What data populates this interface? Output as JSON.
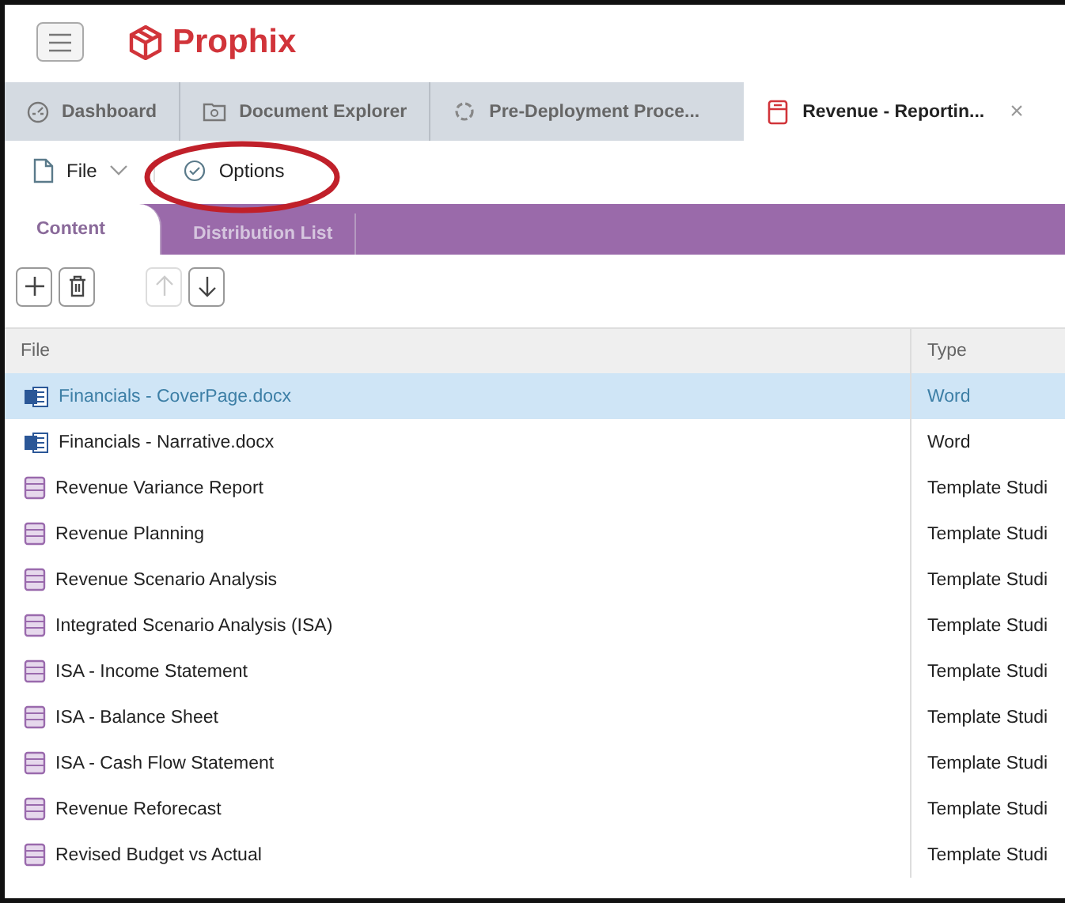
{
  "header": {
    "logo": "Prophix"
  },
  "tabs": [
    {
      "label": "Dashboard",
      "kind": "dashboard",
      "selected": false
    },
    {
      "label": "Document Explorer",
      "kind": "explorer",
      "selected": false
    },
    {
      "label": "Pre-Deployment Proce...",
      "kind": "process",
      "selected": false
    },
    {
      "label": "Revenue - Reportin...",
      "kind": "book",
      "selected": true,
      "close": "×"
    }
  ],
  "toolbar": {
    "file": "File",
    "options": "Options",
    "options_highlighted": true
  },
  "subtabs": [
    {
      "label": "Content",
      "selected": true
    },
    {
      "label": "Distribution List",
      "selected": false
    }
  ],
  "actions": [
    {
      "kind": "add",
      "disabled": false
    },
    {
      "kind": "delete",
      "disabled": false
    },
    {
      "kind": "up",
      "disabled": true
    },
    {
      "kind": "down",
      "disabled": false
    }
  ],
  "table": {
    "columns": [
      "File",
      "Type"
    ],
    "rows": [
      {
        "kind": "word",
        "file": "Financials - CoverPage.docx",
        "type": "Word",
        "selected": true
      },
      {
        "kind": "word",
        "file": "Financials - Narrative.docx",
        "type": "Word",
        "selected": false
      },
      {
        "kind": "template",
        "file": "Revenue Variance Report",
        "type": "Template Studi",
        "selected": false
      },
      {
        "kind": "template",
        "file": "Revenue Planning",
        "type": "Template Studi",
        "selected": false
      },
      {
        "kind": "template",
        "file": "Revenue Scenario Analysis",
        "type": "Template Studi",
        "selected": false
      },
      {
        "kind": "template",
        "file": "Integrated Scenario Analysis (ISA)",
        "type": "Template Studi",
        "selected": false
      },
      {
        "kind": "template",
        "file": "ISA - Income Statement",
        "type": "Template Studi",
        "selected": false
      },
      {
        "kind": "template",
        "file": "ISA - Balance Sheet",
        "type": "Template Studi",
        "selected": false
      },
      {
        "kind": "template",
        "file": "ISA - Cash Flow Statement",
        "type": "Template Studi",
        "selected": false
      },
      {
        "kind": "template",
        "file": "Revenue Reforecast",
        "type": "Template Studi",
        "selected": false
      },
      {
        "kind": "template",
        "file": "Revised Budget vs Actual",
        "type": "Template Studi",
        "selected": false
      }
    ]
  }
}
